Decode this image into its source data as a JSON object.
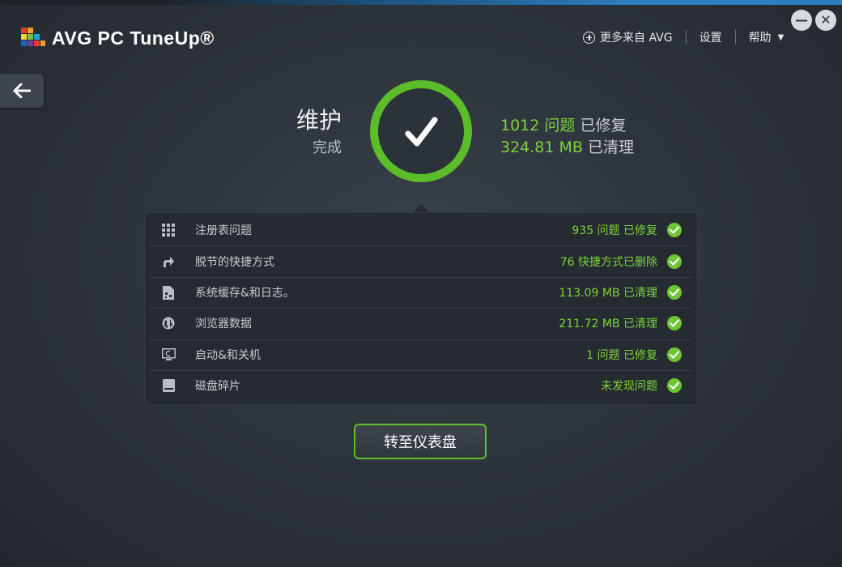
{
  "app": {
    "title": "AVG PC TuneUp®",
    "brand_green": "#6cc531",
    "icon": "avg-logo-icon"
  },
  "window_controls": {
    "minimize_icon": "minimize-icon",
    "close_icon": "close-icon"
  },
  "topnav": {
    "more_label": "更多来自 AVG",
    "settings_label": "设置",
    "help_label": "帮助"
  },
  "header": {
    "title": "维护",
    "subtitle": "完成"
  },
  "summary": {
    "issues_value": "1012 问题",
    "issues_label": "已修复",
    "cleaned_value": "324.81 MB",
    "cleaned_label": "已清理"
  },
  "results": [
    {
      "label": "注册表问题",
      "status": "935 问题 已修复",
      "icon": "grid-icon"
    },
    {
      "label": "脱节的快捷方式",
      "status": "76 快捷方式已删除",
      "icon": "shortcut-arrow-icon"
    },
    {
      "label": "系统缓存&和日志。",
      "status": "113.09 MB 已清理",
      "icon": "file-cache-icon"
    },
    {
      "label": "浏览器数据",
      "status": "211.72 MB 已清理",
      "icon": "globe-icon"
    },
    {
      "label": "启动&和关机",
      "status": "1 问题 已修复",
      "icon": "monitor-icon"
    },
    {
      "label": "磁盘碎片",
      "status": "未发现问题",
      "icon": "disk-icon"
    }
  ],
  "actions": {
    "dashboard_label": "转至仪表盘"
  }
}
